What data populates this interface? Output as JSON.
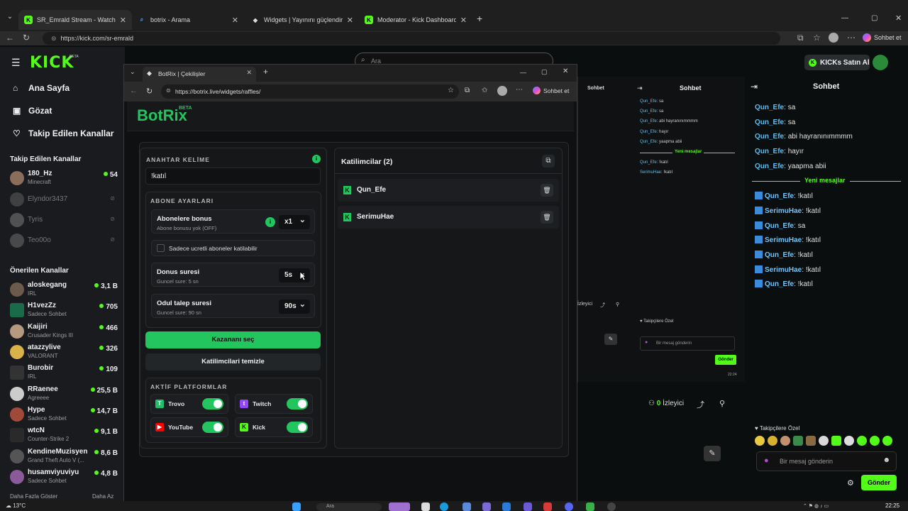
{
  "outer_tabs": [
    {
      "label": "SR_Emrald Stream - Watch Live on",
      "icon": "kick-icon",
      "active": true
    },
    {
      "label": "botrix - Arama",
      "icon": "search-icon",
      "active": false
    },
    {
      "label": "Widgets | Yayınını güçlendirmek iç",
      "icon": "widget-icon",
      "active": false
    },
    {
      "label": "Moderator - Kick Dashboard",
      "icon": "kick-icon",
      "active": false
    }
  ],
  "outer_url": "https://kick.com/sr-emrald",
  "outer_toolbar": {
    "chat_btn": "Sohbet et"
  },
  "kick": {
    "logo": "KICK",
    "logo_badge": "BETA",
    "search_placeholder": "Ara",
    "kicks_btn": "KICKs Satın Al",
    "nav": [
      "Ana Sayfa",
      "Gözat",
      "Takip Edilen Kanallar"
    ],
    "followed_header": "Takip Edilen Kanallar",
    "followed": [
      {
        "name": "180_Hz",
        "cat": "Minecraft",
        "viewers": "54",
        "live": true
      },
      {
        "name": "Elyndor3437",
        "cat": "",
        "viewers": "",
        "live": false
      },
      {
        "name": "Tyris",
        "cat": "",
        "viewers": "",
        "live": false
      },
      {
        "name": "Teo00o",
        "cat": "",
        "viewers": "",
        "live": false
      }
    ],
    "recommended_header": "Önerilen Kanallar",
    "recommended": [
      {
        "name": "aloskegang",
        "cat": "IRL",
        "viewers": "3,1 B"
      },
      {
        "name": "H1vezZz",
        "cat": "Sadece Sohbet",
        "viewers": "705"
      },
      {
        "name": "Kaijiri",
        "cat": "Crusader Kings III",
        "viewers": "466"
      },
      {
        "name": "atazzylive",
        "cat": "VALORANT",
        "viewers": "326"
      },
      {
        "name": "Burobir",
        "cat": "IRL",
        "viewers": "109"
      },
      {
        "name": "RRaenee",
        "cat": "Agreeee",
        "viewers": "25,5 B"
      },
      {
        "name": "Hype",
        "cat": "Sadece Sohbet",
        "viewers": "14,7 B"
      },
      {
        "name": "wtcN",
        "cat": "Counter-Strike 2",
        "viewers": "9,1 B"
      },
      {
        "name": "KendineMuzisyen",
        "cat": "Grand Theft Auto V (...",
        "viewers": "8,6 B"
      },
      {
        "name": "husamviyuviyu",
        "cat": "Sadece Sohbet",
        "viewers": "4,8 B"
      }
    ],
    "show_more": "Daha Fazla Göster",
    "show_less": "Daha Az",
    "chat_header": "Sohbet",
    "chat_messages": [
      {
        "user": "Qun_Efe",
        "text": "sa",
        "badge": false
      },
      {
        "user": "Qun_Efe",
        "text": "sa",
        "badge": false
      },
      {
        "user": "Qun_Efe",
        "text": "abi hayranınımmmm",
        "badge": false
      },
      {
        "user": "Qun_Efe",
        "text": "hayır",
        "badge": false
      },
      {
        "user": "Qun_Efe",
        "text": "yaapma abii",
        "badge": false
      }
    ],
    "new_messages": "Yeni mesajlar",
    "chat_messages_new": [
      {
        "user": "Qun_Efe",
        "text": "!katıl"
      },
      {
        "user": "SerimuHae",
        "text": "!katıl"
      },
      {
        "user": "Qun_Efe",
        "text": "sa"
      },
      {
        "user": "SerimuHae",
        "text": "!katıl"
      },
      {
        "user": "Qun_Efe",
        "text": "!katıl"
      },
      {
        "user": "SerimuHae",
        "text": "!katıl"
      },
      {
        "user": "Qun_Efe",
        "text": "!katıl"
      }
    ],
    "viewer_count": "0",
    "viewer_label": "İzleyici",
    "followers_only": "Takipçilere Özel",
    "chat_placeholder": "Bir mesaj gönderin",
    "send_btn": "Gönder"
  },
  "botrix": {
    "tab_title": "BotRix | Çekilişler",
    "url": "https://botrix.live/widgets/raffles/",
    "chat_btn": "Sohbet et",
    "logo": "BotRix",
    "logo_badge": "BETA",
    "keyword_label": "ANAHTAR KELİME",
    "keyword_value": "!katıl",
    "sub_settings_label": "ABONE AYARLARI",
    "sub_bonus_title": "Abonelere bonus",
    "sub_bonus_sub": "Abone bonusu yok (OFF)",
    "sub_bonus_value": "x1",
    "paid_only_label": "Sadece ucretli aboneler katilabilir",
    "spin_title": "Donus suresi",
    "spin_sub": "Guncel sure: 5 sn",
    "spin_value": "5s",
    "claim_title": "Odul talep suresi",
    "claim_sub": "Guncel sure: 90 sn",
    "claim_value": "90s",
    "pick_winner_btn": "Kazananı seç",
    "clear_btn": "Katilimcilari temizle",
    "platforms_label": "AKTİF PLATFORMLAR",
    "platforms": [
      {
        "name": "Trovo",
        "enabled": true,
        "color": "#1fbf6b"
      },
      {
        "name": "Twitch",
        "enabled": true,
        "color": "#9146ff"
      },
      {
        "name": "YouTube",
        "enabled": true,
        "color": "#ff0000"
      },
      {
        "name": "Kick",
        "enabled": true,
        "color": "#53fc18"
      }
    ],
    "participants_title": "Katilimcilar (2)",
    "participants": [
      "Qun_Efe",
      "SerimuHae"
    ]
  },
  "dashboard_preview": {
    "chat_header": "Sohbet",
    "messages": [
      {
        "user": "Qun_Efe",
        "text": "sa"
      },
      {
        "user": "Qun_Efe",
        "text": "sa"
      },
      {
        "user": "Qun_Efe",
        "text": "abi hayranınımmmm"
      },
      {
        "user": "Qun_Efe",
        "text": "hayır"
      },
      {
        "user": "Qun_Efe",
        "text": "yaapma abii"
      }
    ],
    "new_messages": "Yeni mesajlar",
    "messages_new": [
      {
        "user": "Qun_Efe",
        "text": "!katıl"
      },
      {
        "user": "SerimuHae",
        "text": "!katıl"
      }
    ],
    "viewer_label": "İzleyici",
    "followers_only": "Takipçilere Özel",
    "chat_placeholder": "Bir mesaj gönderin",
    "send_btn": "Gönder",
    "time": "22:24"
  },
  "taskbar": {
    "weather": "13°C",
    "search": "Ara",
    "clock": "22:25"
  },
  "colors": {
    "kick_green": "#53fc18",
    "botrix_green": "#22c55e"
  }
}
